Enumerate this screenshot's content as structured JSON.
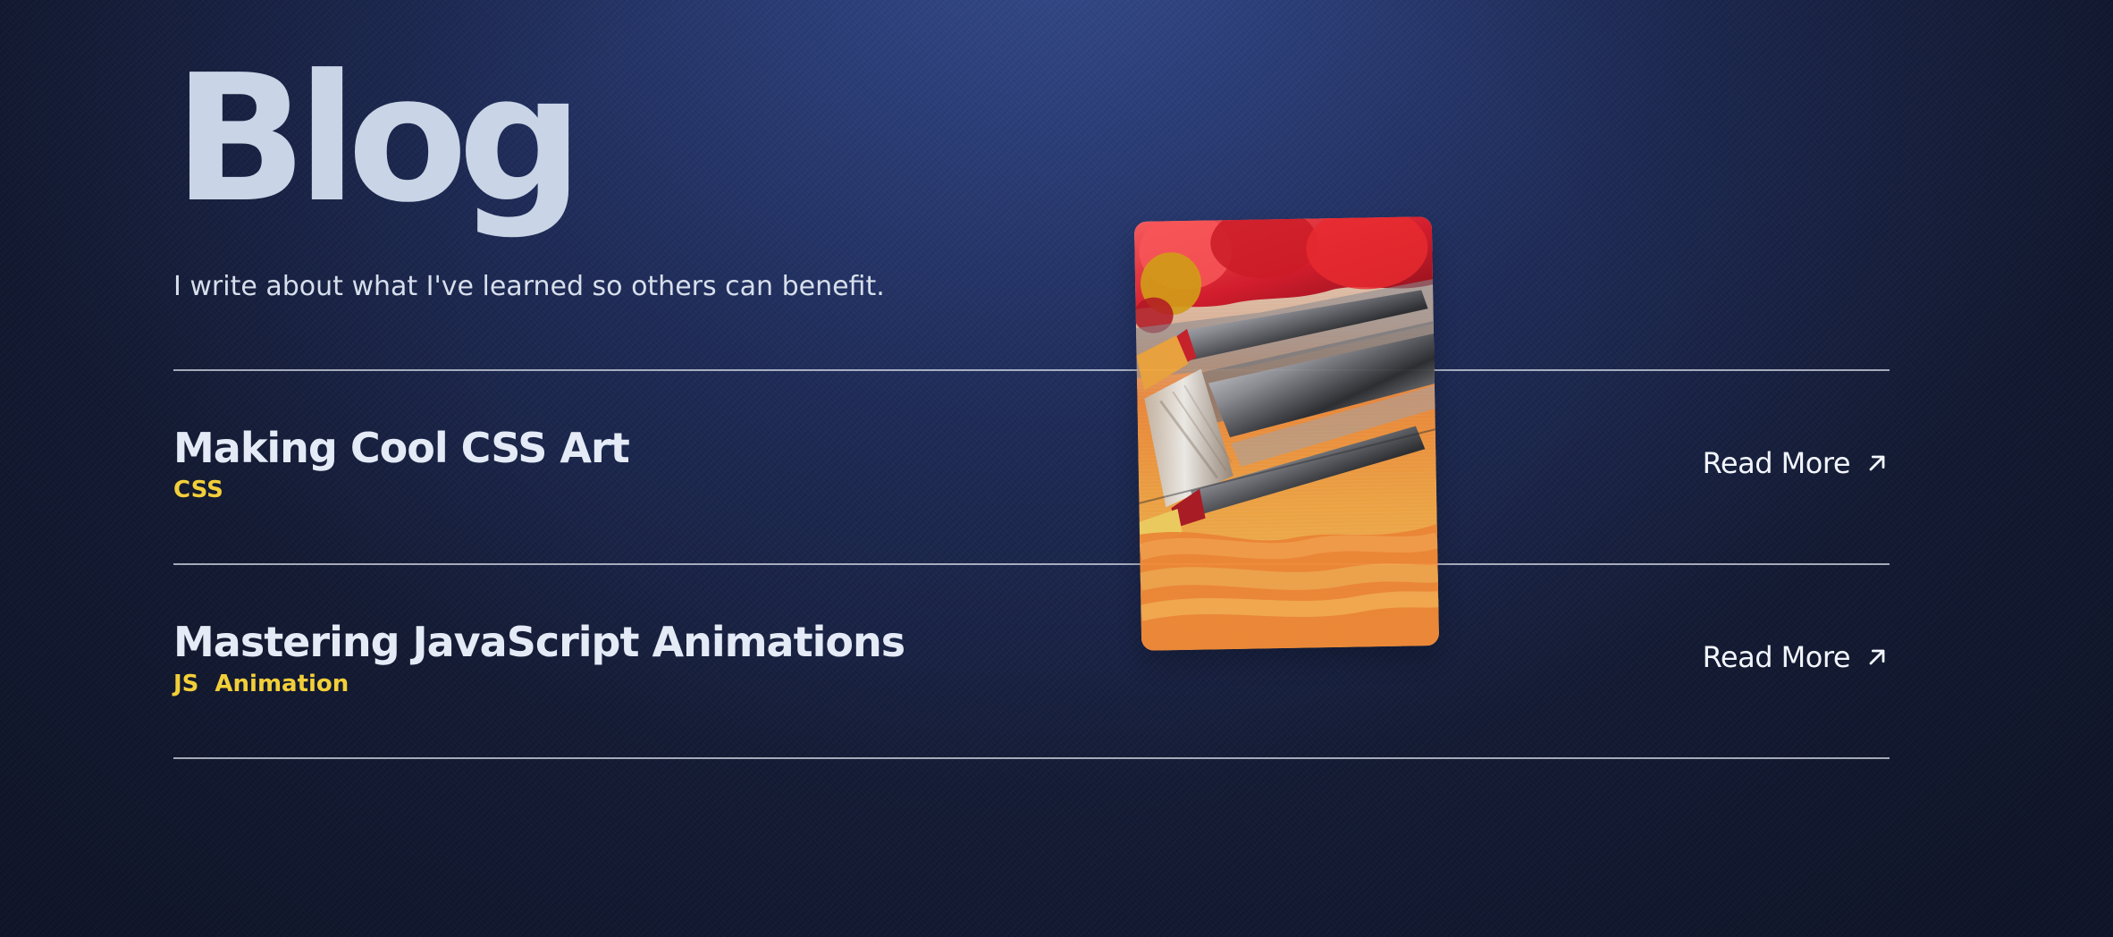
{
  "page": {
    "title": "Blog",
    "subtitle": "I write about what I've learned so others can benefit."
  },
  "posts": [
    {
      "title": "Making Cool CSS Art",
      "tags": [
        "CSS"
      ],
      "read_more": "Read More",
      "icon": "arrow-up-right-icon"
    },
    {
      "title": "Mastering JavaScript Animations",
      "tags": [
        "JS",
        "Animation"
      ],
      "read_more": "Read More",
      "icon": "arrow-up-right-icon"
    }
  ],
  "preview": {
    "icon": "paint-brushes-image"
  },
  "colors": {
    "background": "#1d2a55",
    "heading": "#c9d5e6",
    "tag": "#f2cf39",
    "divider": "#dce2ec",
    "text": "#f2f5fb"
  }
}
